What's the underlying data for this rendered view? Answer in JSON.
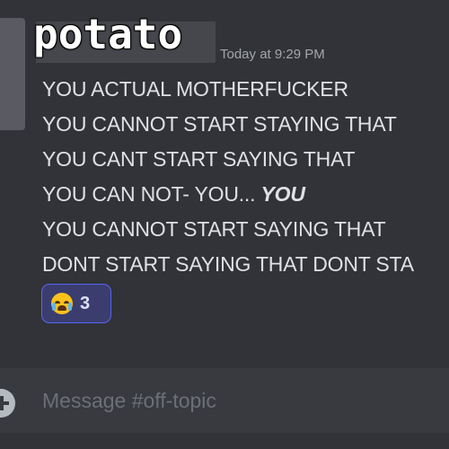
{
  "message": {
    "username": "potato",
    "timestamp": "Today at 9:29 PM",
    "lines": [
      "YOU ACTUAL MOTHERFUCKER",
      "YOU CANNOT START STAYING THAT",
      "YOU CANT START SAYING THAT",
      "YOU CAN NOT- YOU... ",
      "YOU CANNOT START SAYING THAT",
      "DONT START SAYING THAT DONT STA"
    ],
    "line4_emphasis": "YOU",
    "reaction": {
      "emoji": "loudly-crying-face",
      "count": "3"
    }
  },
  "composer": {
    "placeholder": "Message #off-topic"
  },
  "colors": {
    "background": "#313338",
    "text": "#e0e1e5",
    "reaction_border": "#5865f2",
    "composer_bg": "#383a40"
  }
}
